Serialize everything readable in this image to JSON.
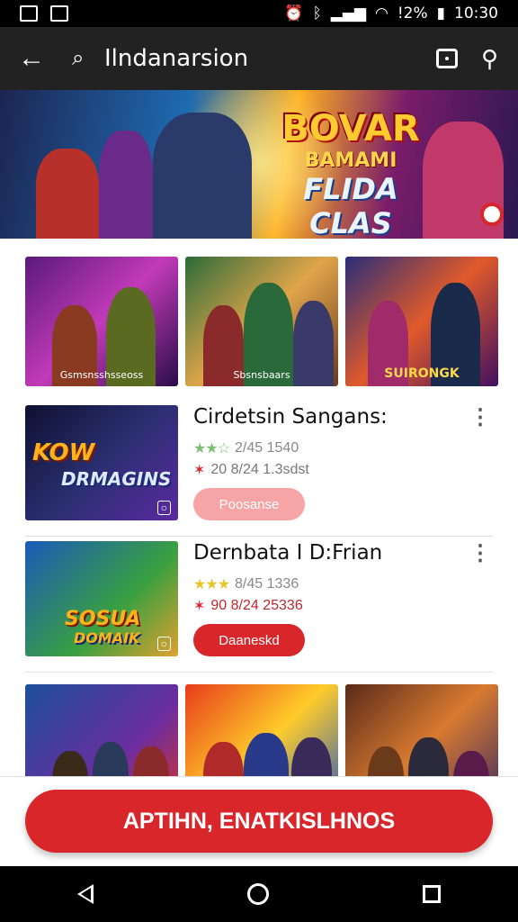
{
  "status_bar": {
    "battery": "!2%",
    "time": "10:30"
  },
  "top_bar": {
    "title": "Ilndanarsion"
  },
  "banner": {
    "line1": "BOVAR",
    "line2": "BAMAMI",
    "line3": "FLIDA CLAS"
  },
  "thumbs_top": [
    {
      "caption": "Gsmsnsshsseoss"
    },
    {
      "caption": "Sbsnsbaars"
    },
    {
      "caption": "SUIRONGK"
    }
  ],
  "list": [
    {
      "title": "Cirdetsin Sangans:",
      "rating": "2/45 1540",
      "price": "20 8/24 1.3sdst",
      "button": "Poosanse",
      "logo1": "KOW",
      "logo2": "DRMAGINS"
    },
    {
      "title": "Dernbata I D:Frian",
      "rating": "8/45 1336",
      "price": "90 8/24 25336",
      "button": "Daaneskd",
      "logo1": "SOSUA",
      "logo2": "DOMAIK"
    }
  ],
  "cta": {
    "label": "APTIHN, ENATKISLHNOS"
  },
  "colors": {
    "accent": "#d8262b",
    "topbar": "#222222"
  }
}
